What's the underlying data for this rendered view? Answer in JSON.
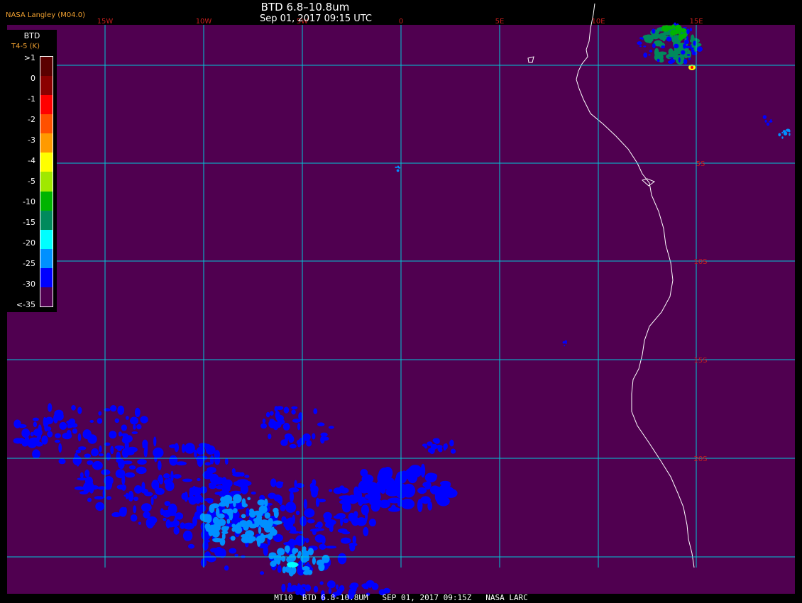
{
  "header": {
    "source": "NASA Langley (M04.0)",
    "title": "BTD 6.8–10.8um",
    "subtitle": "Sep 01, 2017 09:15 UTC"
  },
  "footer": {
    "text": "MT10  BTD 6.8-10.8UM   SEP 01, 2017 09:15Z   NASA LARC"
  },
  "legend": {
    "title": "BTD",
    "subtitle": "T4-5 (K)",
    "ticks": [
      ">1",
      "0",
      "-1",
      "-2",
      "-3",
      "-4",
      "-5",
      "-10",
      "-15",
      "-20",
      "-25",
      "-30",
      "<-35"
    ],
    "colors": [
      "#5a0000",
      "#8b0000",
      "#ff0000",
      "#ff5000",
      "#ff9a00",
      "#ffff00",
      "#a0e800",
      "#00b400",
      "#008a5c",
      "#00ffff",
      "#0090ff",
      "#0000ff",
      "#500050"
    ]
  },
  "map": {
    "background_color": "#500050",
    "grid_color": "#00c8d8",
    "coast_color": "#ffffff",
    "lon_labels": [
      "15W",
      "10W",
      "5W",
      "0",
      "5E",
      "10E",
      "15E"
    ],
    "lat_labels": [
      "5S",
      "10S",
      "15S",
      "20S"
    ],
    "label_color": "#c81e1e"
  }
}
